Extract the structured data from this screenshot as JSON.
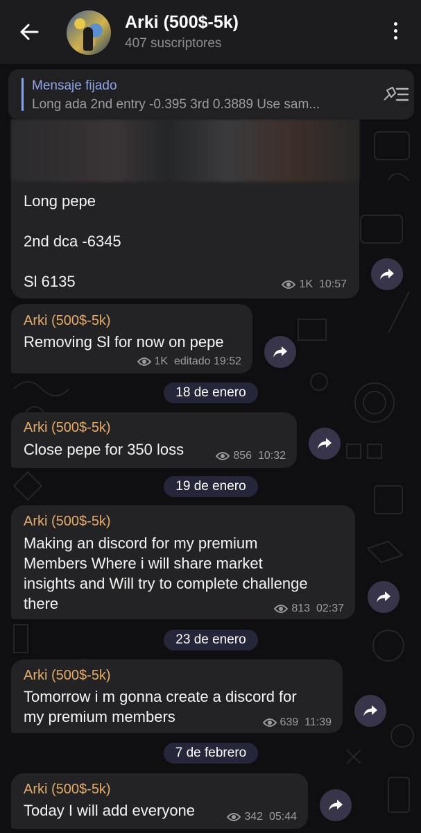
{
  "header": {
    "title": "Arki (500$-5k)",
    "subtitle": "407 suscriptores"
  },
  "pinned": {
    "label": "Mensaje fijado",
    "text": "Long ada   2nd entry -0.395   3rd 0.3889   Use sam..."
  },
  "messages": [
    {
      "author": "",
      "lines": [
        "Long pepe",
        "2nd dca -6345",
        "Sl 6135"
      ],
      "views": "1K",
      "edited": "",
      "time": "10:57"
    },
    {
      "author": "Arki (500$-5k)",
      "lines": [
        "Removing Sl for now on pepe"
      ],
      "views": "1K",
      "edited": "editado",
      "time": "19:52"
    },
    {
      "author": "Arki (500$-5k)",
      "lines": [
        "Close pepe for 350 loss"
      ],
      "views": "856",
      "edited": "",
      "time": "10:32"
    },
    {
      "author": "Arki (500$-5k)",
      "lines": [
        "Making an discord for my premium",
        "Members Where i will share market",
        "insights and Will try to complete challenge",
        "there"
      ],
      "views": "813",
      "edited": "",
      "time": "02:37"
    },
    {
      "author": "Arki (500$-5k)",
      "lines": [
        "Tomorrow i m gonna create a discord for",
        "my premium members"
      ],
      "views": "639",
      "edited": "",
      "time": "11:39"
    },
    {
      "author": "Arki (500$-5k)",
      "lines": [
        "Today I will add everyone"
      ],
      "views": "342",
      "edited": "",
      "time": "05:44"
    }
  ],
  "dates": [
    "18 de enero",
    "19 de enero",
    "23 de enero",
    "7 de febrero"
  ],
  "colors": {
    "author": "#e5ab6a",
    "pinned_accent": "#8fa4e6",
    "bubble": "#232325",
    "share_button": "#38354a"
  },
  "icons": {
    "back": "arrow-left-icon",
    "menu": "more-vertical-icon",
    "pin_list": "pinned-list-icon",
    "views": "eye-icon",
    "share": "share-arrow-icon"
  }
}
